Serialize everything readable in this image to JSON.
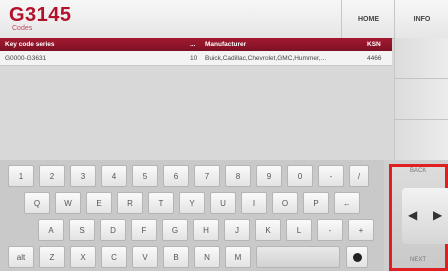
{
  "header": {
    "title": "G3145",
    "subtitle": "Codes",
    "home_label": "HOME",
    "info_label": "INFO"
  },
  "table": {
    "columns": [
      "Key code series",
      "...",
      "Manufacturer",
      "KSN"
    ],
    "rows": [
      [
        "G0000-G3631",
        "10",
        "Buick,Cadillac,Chevrolet,GMC,Hummer,...",
        "4466"
      ]
    ]
  },
  "keyboard": {
    "row1": [
      "1",
      "2",
      "3",
      "4",
      "5",
      "6",
      "7",
      "8",
      "9",
      "0",
      "-",
      "/"
    ],
    "row2": [
      "Q",
      "W",
      "E",
      "R",
      "T",
      "Y",
      "U",
      "I",
      "O",
      "P",
      "←"
    ],
    "row3": [
      "A",
      "S",
      "D",
      "F",
      "G",
      "H",
      "J",
      "K",
      "L",
      "-",
      "+"
    ],
    "row4": [
      "alt",
      "Z",
      "X",
      "C",
      "V",
      "B",
      "N",
      "M",
      "",
      ""
    ]
  },
  "nav": {
    "back_label": "BACK",
    "next_label": "NEXT",
    "left_arrow": "◀",
    "right_arrow": "▶"
  },
  "colors": {
    "brand": "#b3122d",
    "highlight": "#e02020"
  }
}
